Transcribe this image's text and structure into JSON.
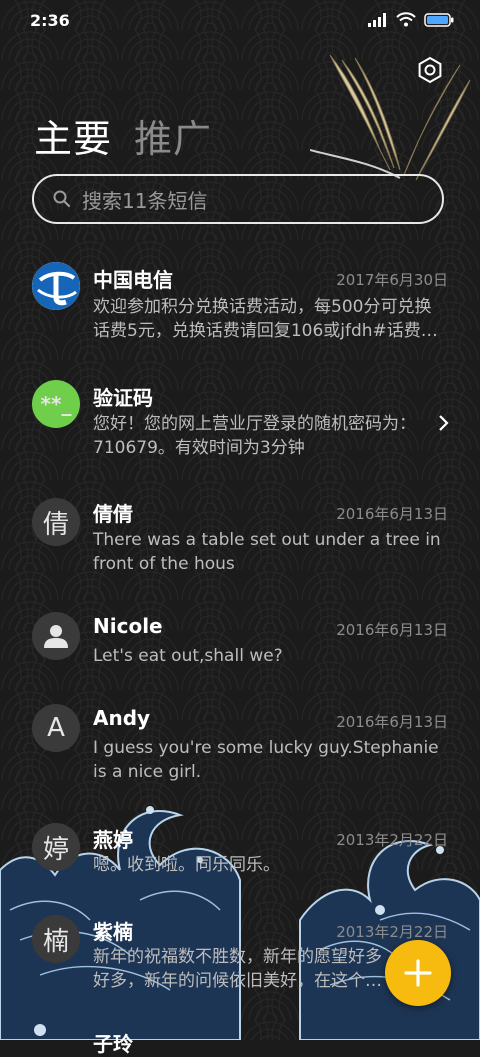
{
  "status_bar": {
    "time": "2:36"
  },
  "tabs": {
    "main": "主要",
    "promo": "推广"
  },
  "search": {
    "placeholder": "搜索11条短信"
  },
  "messages": [
    {
      "name": "中国电信",
      "date": "2017年6月30日",
      "preview": "欢迎参加积分兑换话费活动，每500分可兑换话费5元，兑换话费请回复106或jfdh#话费…",
      "avatar_icon": "china-telecom-logo"
    },
    {
      "name": "验证码",
      "date": "",
      "preview": "您好！您的网上营业厅登录的随机密码为：710679。有效时间为3分钟",
      "avatar_text": "**_",
      "avatar_color": "#6fcf4a"
    },
    {
      "name": "倩倩",
      "date": "2016年6月13日",
      "preview": "There was a table set out under a tree in front of the hous",
      "avatar_text": "倩"
    },
    {
      "name": "Nicole",
      "date": "2016年6月13日",
      "preview": "Let's eat out,shall we?",
      "avatar_icon": "person-icon"
    },
    {
      "name": "Andy",
      "date": "2016年6月13日",
      "preview": "I guess you're some lucky guy.Stephanie is a nice girl.",
      "avatar_text": "A"
    },
    {
      "name": "燕婷",
      "date": "2013年2月22日",
      "preview": "嗯。收到啦。同乐同乐。",
      "avatar_text": "婷"
    },
    {
      "name": "紫楠",
      "date": "2013年2月22日",
      "preview": "新年的祝福数不胜数，新年的愿望好多好多，新年的问候依旧美好，在这个温馨的时刻",
      "avatar_text": "楠"
    },
    {
      "name": "子玲",
      "date": "",
      "preview": "",
      "avatar_text": ""
    }
  ],
  "colors": {
    "accent": "#f6bb0e",
    "background": "#1b1b1b",
    "verify_avatar": "#6fcf4a",
    "telecom_blue": "#1565b8"
  }
}
